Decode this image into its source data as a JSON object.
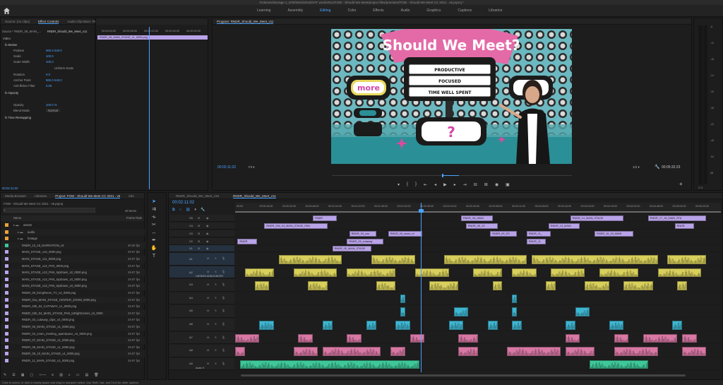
{
  "app": {
    "title": "/Volumes/Storage 2_6TB/Work/2016/NYF work/2021/FOW - Should We Meet/project files/premiere/FOW - Should We Meet CC 2021 - v5.prproj *"
  },
  "workspaces": [
    "Learning",
    "Assembly",
    "Editing",
    "Color",
    "Effects",
    "Audio",
    "Graphics",
    "Captions",
    "Libraries"
  ],
  "workspace_active": "Editing",
  "source_panel": {
    "tabs": [
      "Source: (no clips)",
      "Effect Controls",
      "Audio Clip Mixer: RNDR_Should_We_Meet_v11",
      "Metadata"
    ],
    "active_tab": "Effect Controls",
    "source_select": "Source * RNDR_08_MAIN_...",
    "sequence_select": "RNDR_Should_We_Meet_v11",
    "ruler": [
      "00:00:04:00",
      "00:00:08:00",
      "00:00:12:00",
      "00:00:16:00",
      "00:00:20:00"
    ],
    "clip_bar": "RNDR_08_MAIN_STAGE_v1_0000.png",
    "section_video": "Video",
    "rows": [
      {
        "label": "fx  Motion",
        "value": ""
      },
      {
        "label": "Position",
        "value": "960.0    540.0"
      },
      {
        "label": "Scale",
        "value": "100.0"
      },
      {
        "label": "Scale Width",
        "value": "100.0"
      },
      {
        "label": "",
        "value": "Uniform Scale"
      },
      {
        "label": "Rotation",
        "value": "0.0"
      },
      {
        "label": "Anchor Point",
        "value": "960.0    540.0"
      },
      {
        "label": "Anti-flicker Filter",
        "value": "0.00"
      },
      {
        "label": "fx  Opacity",
        "value": ""
      },
      {
        "label": "Opacity",
        "value": "100.0 %"
      },
      {
        "label": "Blend Mode",
        "value": "Normal"
      },
      {
        "label": "fx  Time Remapping",
        "value": ""
      }
    ],
    "timecode": "00:02:11:02"
  },
  "program": {
    "title": "Program: RNDR_Should_We_Meet_v11",
    "timecode": "00:02:11:02",
    "fit": "Fit",
    "quality": "1/2",
    "duration": "00:05:32:23",
    "video_text": {
      "logo": "Should We Meet?",
      "list": [
        "PRODUCTIVE",
        "FOCUSED",
        "TIME WELL SPENT"
      ],
      "left_screen": "more",
      "bottom_screen": "?"
    }
  },
  "meters": {
    "labels": [
      "-6",
      "-12",
      "-18",
      "-24",
      "-30",
      "-36",
      "-42",
      "-48",
      "-54",
      "dB"
    ],
    "footer": "S   S"
  },
  "project": {
    "tabs": [
      "Media Browser",
      "Libraries",
      "Project: FOW - Should We Meet CC 2021 - v5",
      "Info"
    ],
    "active_tab": "Project: FOW - Should We Meet CC 2021 - v5",
    "path": "FOW - Should We Meet CC 2021 - v5.prproj",
    "items_count": "48 Items",
    "col_name": "Name",
    "col_frame": "Frame Rate",
    "rows": [
      {
        "name": "assets",
        "rate": "",
        "color": "#e8a23a",
        "indent": 0
      },
      {
        "name": "audio",
        "rate": "",
        "color": "#e8a23a",
        "indent": 1
      },
      {
        "name": "footage",
        "rate": "",
        "color": "#e8a23a",
        "indent": 1
      },
      {
        "name": "RNDR_13_16_NARRATION_v3",
        "rate": "30.00 fps",
        "color": "#3fc79a",
        "indent": 2
      },
      {
        "name": "MAIN_STAGE_v10_0000.png",
        "rate": "29.97 fps",
        "color": "#b9a3e8",
        "indent": 2
      },
      {
        "name": "MAIN_STAGE_v11_0000.png",
        "rate": "29.97 fps",
        "color": "#b9a3e8",
        "indent": 2
      },
      {
        "name": "MAIN_STAGE_v12_PAN_0000.png",
        "rate": "29.97 fps",
        "color": "#b9a3e8",
        "indent": 2
      },
      {
        "name": "MAIN_STAGE_v13_PAN_topDown_v2_0000.png",
        "rate": "29.97 fps",
        "color": "#b9a3e8",
        "indent": 2
      },
      {
        "name": "MAIN_STAGE_v13_PAN_topDown_v3_0000.png",
        "rate": "29.97 fps",
        "color": "#b9a3e8",
        "indent": 2
      },
      {
        "name": "MAIN_STAGE_v13_PAN_topDown_v3_0000.png",
        "rate": "29.97 fps",
        "color": "#b9a3e8",
        "indent": 2
      },
      {
        "name": "RNDR_00_livingRoom_TV_v4_0000.png",
        "rate": "29.97 fps",
        "color": "#b9a3e8",
        "indent": 2
      },
      {
        "name": "RNDR_01a_MAIN_STAGE_CENTER_ZOOM_0000.png",
        "rate": "29.97 fps",
        "color": "#b9a3e8",
        "indent": 2
      },
      {
        "name": "RNDR_02b_04_CUTAWAY_v1_0000.png",
        "rate": "29.97 fps",
        "color": "#b9a3e8",
        "indent": 2
      },
      {
        "name": "RNDR_02b_04_MAIN_STAGE_PAN_toRightCenter_v3_0000",
        "rate": "29.97 fps",
        "color": "#b9a3e8",
        "indent": 2
      },
      {
        "name": "RNDR_03_cutaway_clips_v2_0000.png",
        "rate": "29.97 fps",
        "color": "#b9a3e8",
        "indent": 2
      },
      {
        "name": "RNDR_03_MAIN_STAGE_v1_0000.png",
        "rate": "29.97 fps",
        "color": "#b9a3e8",
        "indent": 2
      },
      {
        "name": "RNDR_04_zoom_meeting_upanSpace_v2_0000.png",
        "rate": "29.97 fps",
        "color": "#b9a3e8",
        "indent": 2
      },
      {
        "name": "RNDR_07_MAIN_STAGE_v1_0000.png",
        "rate": "29.97 fps",
        "color": "#b9a3e8",
        "indent": 2
      },
      {
        "name": "RNDR_08_MAIN_STAGE_v1_0000.png",
        "rate": "29.97 fps",
        "color": "#b9a3e8",
        "indent": 2
      },
      {
        "name": "RNDR_09_10_MAIN_STAGE_v1_0000.png",
        "rate": "29.97 fps",
        "color": "#b9a3e8",
        "indent": 2
      },
      {
        "name": "RNDR_11_MAIN_STAGE_v1_0000.png",
        "rate": "29.97 fps",
        "color": "#b9a3e8",
        "indent": 2
      }
    ]
  },
  "timeline": {
    "tabs": [
      "RNDR_Should_We_Meet_v10",
      "RNDR_Should_We_Meet_v11"
    ],
    "active_tab": "RNDR_Should_We_Meet_v11",
    "timecode": "00:02:11:02",
    "ruler": [
      "00:00",
      "00:00:16:00",
      "00:00:32:00",
      "00:00:48:00",
      "00:01:04:00",
      "00:01:20:00",
      "00:01:36:00",
      "00:01:52:00",
      "00:02:08:00",
      "00:02:24:00",
      "00:02:40:00",
      "00:02:56:00",
      "00:03:12:00",
      "00:03:28:00",
      "00:03:44:00",
      "00:04:00:00",
      "00:04:16:00",
      "00:04:32:00",
      "00:04:48:00",
      "00:05:04:00",
      "00:05:20:00"
    ],
    "video_tracks": [
      "V5",
      "V4",
      "V3",
      "V2",
      "V1"
    ],
    "audio_tracks": [
      "A1",
      "A2",
      "A3",
      "A4",
      "A5",
      "A6",
      "A7",
      "A8",
      "A9"
    ],
    "audio_names": {
      "A2": "UNSEEN ANNOUNCER",
      "A9": "Audio 9"
    },
    "video_clips": [
      {
        "label": "RNDR",
        "track": 0,
        "start": 0.16,
        "len": 0.05
      },
      {
        "label": "RNDR_08_MAIN",
        "track": 0,
        "start": 0.465,
        "len": 0.065
      },
      {
        "label": "RNDR_14_MAIN_STAGE",
        "track": 0,
        "start": 0.69,
        "len": 0.11
      },
      {
        "label": "RNDR_17_18_MAIN_STA",
        "track": 0,
        "start": 0.85,
        "len": 0.12
      },
      {
        "label": "RNDR_02b_04_MAIN_STAGE_PAN",
        "track": 1,
        "start": 0.06,
        "len": 0.13
      },
      {
        "label": "RNDR_09_10",
        "track": 1,
        "start": 0.475,
        "len": 0.065
      },
      {
        "label": "RNDR_13_MAIN",
        "track": 1,
        "start": 0.645,
        "len": 0.065
      },
      {
        "label": "RNDR",
        "track": 1,
        "start": 0.905,
        "len": 0.04
      },
      {
        "label": "RNDR_04_zoo",
        "track": 2,
        "start": 0.235,
        "len": 0.055
      },
      {
        "label": "RNDR_04_zoom_m",
        "track": 2,
        "start": 0.315,
        "len": 0.07
      },
      {
        "label": "RNDR_09_ZO",
        "track": 2,
        "start": 0.525,
        "len": 0.055
      },
      {
        "label": "RNDR_11_",
        "track": 2,
        "start": 0.6,
        "len": 0.05
      },
      {
        "label": "RNDR_15_16_MAIN",
        "track": 2,
        "start": 0.74,
        "len": 0.08
      },
      {
        "label": "RNDR",
        "track": 3,
        "start": 0.005,
        "len": 0.04
      },
      {
        "label": "RNDR_03_cutaway",
        "track": 3,
        "start": 0.23,
        "len": 0.075
      },
      {
        "label": "RNDR_11",
        "track": 3,
        "start": 0.6,
        "len": 0.04
      },
      {
        "label": "RNDR_05_MAIN_STAGE",
        "track": 4,
        "start": 0.2,
        "len": 0.08
      }
    ]
  },
  "status_text": "Click to select, or click in empty space and drag to marquee select. Use Shift, Opt, and Cmd for other options."
}
